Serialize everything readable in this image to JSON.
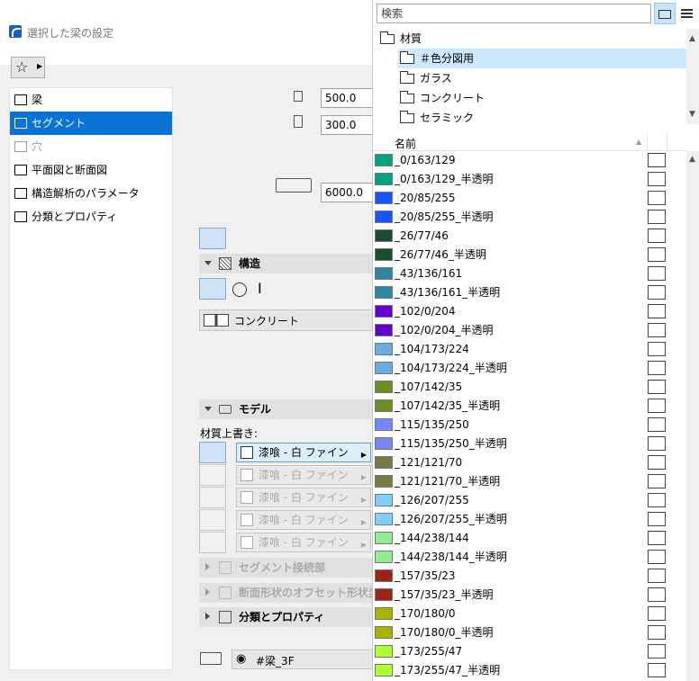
{
  "dialog": {
    "title": "選択した梁の設定",
    "nav": [
      {
        "label": "梁",
        "icon": "beam-icon",
        "state": "normal"
      },
      {
        "label": "セグメント",
        "icon": "segment-icon",
        "state": "selected"
      },
      {
        "label": "穴",
        "icon": "hole-icon",
        "state": "disabled"
      },
      {
        "label": "平面図と断面図",
        "icon": "floorplan-section-icon",
        "state": "normal"
      },
      {
        "label": "構造解析のパラメータ",
        "icon": "structural-analysis-icon",
        "state": "normal"
      },
      {
        "label": "分類とプロパティ",
        "icon": "classification-icon",
        "state": "normal"
      }
    ],
    "height_value": "500.0",
    "width_value": "300.0",
    "length_value": "6000.0",
    "sections": {
      "structure": "構造",
      "model": "モデル",
      "segment_joint": "セグメント接続部",
      "offset": "断面形状のオフセット形状変更",
      "classification": "分類とプロパティ"
    },
    "building_material": "コンクリート",
    "override_label": "材質上書き:",
    "overrides": [
      "漆喰 - 白 ファイン",
      "漆喰 - 白 ファイン",
      "漆喰 - 白 ファイン",
      "漆喰 - 白 ファイン",
      "漆喰 - 白 ファイン"
    ],
    "layer": "#梁_3F"
  },
  "picker": {
    "search_placeholder": "検索",
    "tree": [
      {
        "label": "材質",
        "level": 0,
        "selected": false
      },
      {
        "label": "＃色分図用",
        "level": 1,
        "selected": true
      },
      {
        "label": "ガラス",
        "level": 1,
        "selected": false
      },
      {
        "label": "コンクリート",
        "level": 1,
        "selected": false
      },
      {
        "label": "セラミック",
        "level": 1,
        "selected": false
      }
    ],
    "column_name": "名前",
    "materials": [
      {
        "name": "_0/163/129",
        "color": "#00a381"
      },
      {
        "name": "_0/163/129_半透明",
        "color": "#00a381"
      },
      {
        "name": "_20/85/255",
        "color": "#1455ff"
      },
      {
        "name": "_20/85/255_半透明",
        "color": "#1455ff"
      },
      {
        "name": "_26/77/46",
        "color": "#1a4d2e"
      },
      {
        "name": "_26/77/46_半透明",
        "color": "#1a4d2e"
      },
      {
        "name": "_43/136/161",
        "color": "#2b88a1"
      },
      {
        "name": "_43/136/161_半透明",
        "color": "#2b88a1"
      },
      {
        "name": "_102/0/204",
        "color": "#6600cc"
      },
      {
        "name": "_102/0/204_半透明",
        "color": "#6600cc"
      },
      {
        "name": "_104/173/224",
        "color": "#68ade0"
      },
      {
        "name": "_104/173/224_半透明",
        "color": "#68ade0"
      },
      {
        "name": "_107/142/35",
        "color": "#6b8e23"
      },
      {
        "name": "_107/142/35_半透明",
        "color": "#6b8e23"
      },
      {
        "name": "_115/135/250",
        "color": "#7387fa"
      },
      {
        "name": "_115/135/250_半透明",
        "color": "#7387fa"
      },
      {
        "name": "_121/121/70",
        "color": "#797946"
      },
      {
        "name": "_121/121/70_半透明",
        "color": "#797946"
      },
      {
        "name": "_126/207/255",
        "color": "#7ecfff"
      },
      {
        "name": "_126/207/255_半透明",
        "color": "#7ecfff"
      },
      {
        "name": "_144/238/144",
        "color": "#90ee90"
      },
      {
        "name": "_144/238/144_半透明",
        "color": "#90ee90"
      },
      {
        "name": "_157/35/23",
        "color": "#9d2317"
      },
      {
        "name": "_157/35/23_半透明",
        "color": "#9d2317"
      },
      {
        "name": "_170/180/0",
        "color": "#aab400"
      },
      {
        "name": "_170/180/0_半透明",
        "color": "#aab400"
      },
      {
        "name": "_173/255/47",
        "color": "#adff2f"
      },
      {
        "name": "_173/255/47_半透明",
        "color": "#adff2f"
      }
    ]
  }
}
